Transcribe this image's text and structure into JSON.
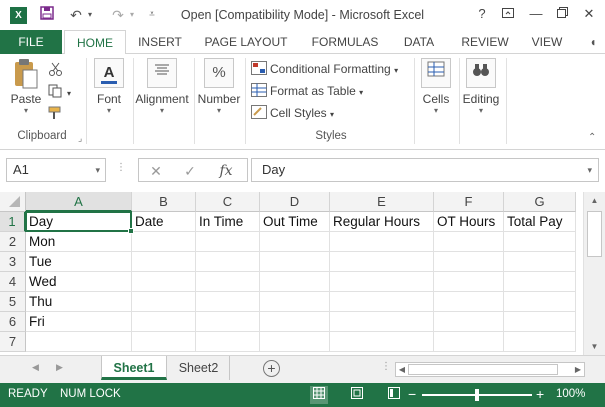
{
  "colors": {
    "excel_green": "#217346",
    "header_bg": "#f3f3f3",
    "selected_header_bg": "#e1e1e1"
  },
  "titlebar": {
    "title": "Open  [Compatibility Mode] - Microsoft Excel",
    "help": "?",
    "icons": [
      "excel-icon",
      "save-icon",
      "undo-icon",
      "redo-icon",
      "customize-icon",
      "ribbon-display-icon",
      "minimize-icon",
      "restore-icon",
      "close-icon"
    ]
  },
  "tabs": {
    "file": "FILE",
    "items": [
      {
        "label": "HOME"
      },
      {
        "label": "INSERT"
      },
      {
        "label": "PAGE LAYOUT"
      },
      {
        "label": "FORMULAS"
      },
      {
        "label": "DATA"
      },
      {
        "label": "REVIEW"
      },
      {
        "label": "VIEW"
      }
    ]
  },
  "ribbon": {
    "paste": "Paste",
    "clipboard": "Clipboard",
    "font": "Font",
    "alignment": "Alignment",
    "number": "Number",
    "conditional_formatting": "Conditional Formatting",
    "format_as_table": "Format as Table",
    "cell_styles": "Cell Styles",
    "styles": "Styles",
    "cells": "Cells",
    "editing": "Editing"
  },
  "formula_bar": {
    "name_box": "A1",
    "formula": "Day",
    "fx": "fx"
  },
  "sheet": {
    "columns": [
      "A",
      "B",
      "C",
      "D",
      "E",
      "F",
      "G"
    ],
    "rows": [
      "1",
      "2",
      "3",
      "4",
      "5",
      "6",
      "7"
    ],
    "cells": [
      [
        "Day",
        "Date",
        "In Time",
        "Out Time",
        "Regular Hours",
        "OT Hours",
        "Total Pay"
      ],
      [
        "Mon",
        "",
        "",
        "",
        "",
        "",
        ""
      ],
      [
        "Tue",
        "",
        "",
        "",
        "",
        "",
        ""
      ],
      [
        "Wed",
        "",
        "",
        "",
        "",
        "",
        ""
      ],
      [
        "Thu",
        "",
        "",
        "",
        "",
        "",
        ""
      ],
      [
        "Fri",
        "",
        "",
        "",
        "",
        "",
        ""
      ],
      [
        "",
        "",
        "",
        "",
        "",
        "",
        ""
      ]
    ],
    "active_cell": "A1"
  },
  "sheet_tabs": {
    "tabs": [
      {
        "label": "Sheet1",
        "active": true
      },
      {
        "label": "Sheet2",
        "active": false
      }
    ],
    "add": "+"
  },
  "status": {
    "ready": "READY",
    "num_lock": "NUM LOCK",
    "zoom": "100%",
    "zoom_minus": "−",
    "zoom_plus": "+",
    "zoom_level_pct": 100
  }
}
